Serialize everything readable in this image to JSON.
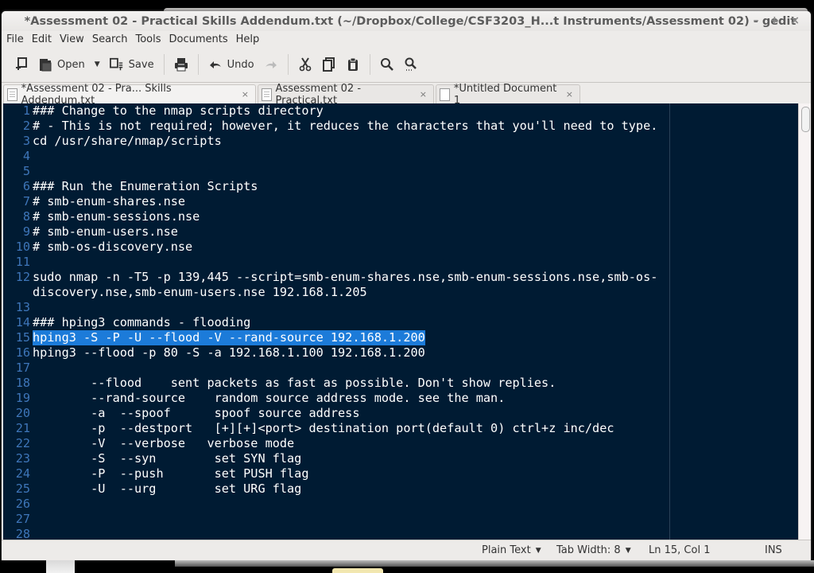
{
  "window": {
    "title": "*Assessment 02 - Practical Skills Addendum.txt (~/Dropbox/College/CSF3203_H...t Instruments/Assessment 02) - gedit",
    "controls": {
      "minimize": "–",
      "maximize": "+",
      "close": "×"
    }
  },
  "menubar": {
    "items": [
      "File",
      "Edit",
      "View",
      "Search",
      "Tools",
      "Documents",
      "Help"
    ]
  },
  "toolbar": {
    "new_icon": "new-document-icon",
    "open_label": "Open",
    "save_label": "Save",
    "print_icon": "print-icon",
    "undo_label": "Undo",
    "redo_icon": "redo-icon",
    "cut_icon": "cut-icon",
    "copy_icon": "copy-icon",
    "paste_icon": "paste-icon",
    "find_icon": "search-icon",
    "replace_icon": "search-replace-icon"
  },
  "tabs": [
    {
      "label": "*Assessment 02 - Pra... Skills Addendum.txt",
      "active": true,
      "close": "×"
    },
    {
      "label": "Assessment 02 - Practical.txt",
      "active": false,
      "close": "×"
    },
    {
      "label": "*Untitled Document 1",
      "active": false,
      "close": "×"
    }
  ],
  "editor": {
    "theme_colors": {
      "background": "#001b33",
      "text": "#ffffff",
      "line_numbers": "#3e76b9",
      "selection": "#1c7bd9"
    },
    "lines": [
      {
        "n": "1",
        "text": "### Change to the nmap scripts directory"
      },
      {
        "n": "2",
        "text": "# - This is not required; however, it reduces the characters that you'll need to type."
      },
      {
        "n": "3",
        "text": "cd /usr/share/nmap/scripts"
      },
      {
        "n": "4",
        "text": ""
      },
      {
        "n": "5",
        "text": ""
      },
      {
        "n": "6",
        "text": "### Run the Enumeration Scripts"
      },
      {
        "n": "7",
        "text": "# smb-enum-shares.nse"
      },
      {
        "n": "8",
        "text": "# smb-enum-sessions.nse"
      },
      {
        "n": "9",
        "text": "# smb-enum-users.nse"
      },
      {
        "n": "10",
        "text": "# smb-os-discovery.nse"
      },
      {
        "n": "11",
        "text": ""
      },
      {
        "n": "12",
        "text": "sudo nmap -n -T5 -p 139,445 --script=smb-enum-shares.nse,smb-enum-sessions.nse,smb-os-"
      },
      {
        "n": "",
        "text": "discovery.nse,smb-enum-users.nse 192.168.1.205"
      },
      {
        "n": "13",
        "text": ""
      },
      {
        "n": "14",
        "text": "### hping3 commands - flooding"
      },
      {
        "n": "15",
        "text": "hping3 -S -P -U --flood -V --rand-source 192.168.1.200",
        "selected": true
      },
      {
        "n": "16",
        "text": "hping3 --flood -p 80 -S -a 192.168.1.100 192.168.1.200"
      },
      {
        "n": "17",
        "text": ""
      },
      {
        "n": "18",
        "text": "        --flood    sent packets as fast as possible. Don't show replies."
      },
      {
        "n": "19",
        "text": "        --rand-source    random source address mode. see the man."
      },
      {
        "n": "20",
        "text": "        -a  --spoof      spoof source address"
      },
      {
        "n": "21",
        "text": "        -p  --destport   [+][+]<port> destination port(default 0) ctrl+z inc/dec"
      },
      {
        "n": "22",
        "text": "        -V  --verbose   verbose mode"
      },
      {
        "n": "23",
        "text": "        -S  --syn        set SYN flag"
      },
      {
        "n": "24",
        "text": "        -P  --push       set PUSH flag"
      },
      {
        "n": "25",
        "text": "        -U  --urg        set URG flag"
      },
      {
        "n": "26",
        "text": ""
      },
      {
        "n": "27",
        "text": ""
      },
      {
        "n": "28",
        "text": ""
      }
    ]
  },
  "statusbar": {
    "language": "Plain Text",
    "tab_width": "Tab Width: 8",
    "position": "Ln 15, Col 1",
    "mode": "INS",
    "caret": "▼"
  }
}
